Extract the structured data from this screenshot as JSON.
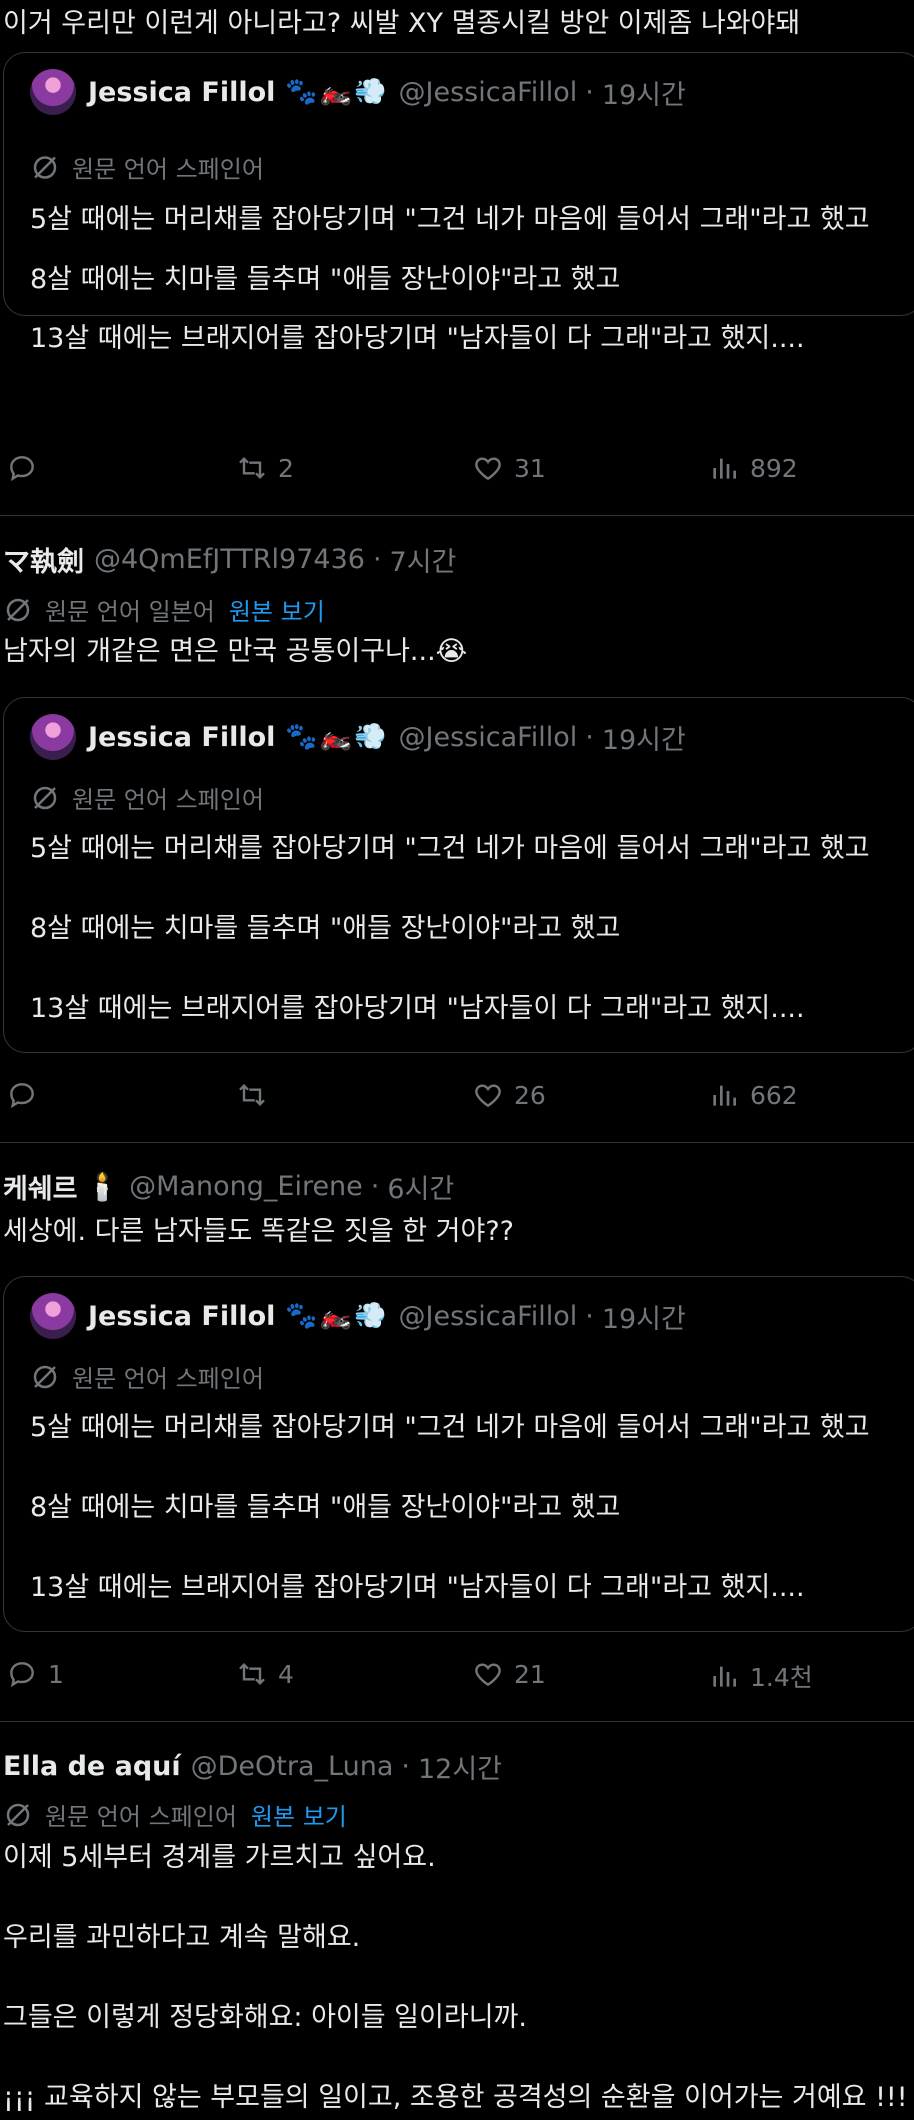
{
  "top_text": "이거 우리만 이런게 아니라고? 씨발 XY 멸종시킬 방안 이제좀 나와야돼",
  "quoted_tweet": {
    "name": "Jessica Fillol",
    "emoji": "🐾🏍️💨",
    "handle": "@JessicaFillol",
    "time": "19시간",
    "translate_label": "원문 언어 스페인어",
    "lines": [
      "5살 때에는 머리채를 잡아당기며 \"그건 네가 마음에 들어서 그래\"라고 했고",
      "8살 때에는 치마를 들추며 \"애들 장난이야\"라고 했고",
      "13살 때에는 브래지어를 잡아당기며 \"남자들이 다 그래\"라고 했지...."
    ]
  },
  "post1": {
    "actions": {
      "reply": "",
      "retweet": "2",
      "like": "31",
      "views": "892"
    }
  },
  "post2": {
    "name": "マ執劍",
    "handle": "@4QmEfJTTRl97436",
    "time": "7시간",
    "translate_label": "원문 언어 일본어",
    "show_original": "원본 보기",
    "text": "남자의 개같은 면은 만국 공통이구나...😭",
    "actions": {
      "reply": "",
      "retweet": "",
      "like": "26",
      "views": "662"
    }
  },
  "post3": {
    "name": "케쉐르",
    "name_emoji": "🕯️",
    "handle": "@Manong_Eirene",
    "time": "6시간",
    "text": "세상에. 다른 남자들도 똑같은 짓을 한 거야??",
    "actions": {
      "reply": "1",
      "retweet": "4",
      "like": "21",
      "views": "1.4천"
    }
  },
  "post4": {
    "name": "Ella de aquí",
    "handle": "@DeOtra_Luna",
    "time": "12시간",
    "translate_label": "원문 언어 스페인어",
    "show_original": "원본 보기",
    "lines": [
      "이제 5세부터 경계를 가르치고 싶어요.",
      "우리를 과민하다고 계속 말해요.",
      "그들은 이렇게 정당화해요: 아이들 일이라니까.",
      "¡¡¡ 교육하지 않는 부모들의 일이고, 조용한 공격성의 순환을 이어가는 거예요 !!!"
    ]
  },
  "colors": {
    "background": "#000000",
    "text": "#e7e9ea",
    "muted": "#71767b",
    "link": "#1d9bf0",
    "border": "#333639"
  }
}
